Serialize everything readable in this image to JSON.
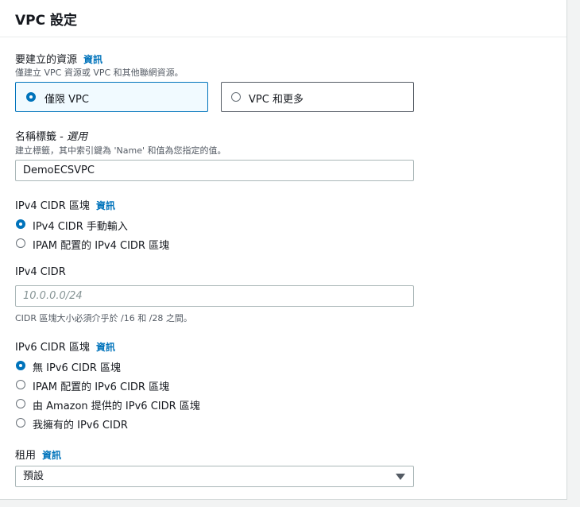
{
  "panel": {
    "title": "VPC 設定"
  },
  "resources": {
    "label": "要建立的資源",
    "info": "資訊",
    "description": "僅建立 VPC 資源或 VPC 和其他聯網資源。",
    "options": [
      {
        "label": "僅限 VPC",
        "selected": true
      },
      {
        "label": "VPC 和更多",
        "selected": false
      }
    ]
  },
  "name_tag": {
    "label": "名稱標籤 - ",
    "optional": "選用",
    "description": "建立標籤，其中索引鍵為 'Name' 和值為您指定的值。",
    "value": "DemoECSVPC"
  },
  "ipv4_block": {
    "label": "IPv4 CIDR 區塊",
    "info": "資訊",
    "options": [
      {
        "label": "IPv4 CIDR 手動輸入",
        "selected": true
      },
      {
        "label": "IPAM 配置的 IPv4 CIDR 區塊",
        "selected": false
      }
    ]
  },
  "ipv4_cidr": {
    "label": "IPv4 CIDR",
    "placeholder": "10.0.0.0/24",
    "hint": "CIDR 區塊大小必須介乎於 /16 和 /28 之間。"
  },
  "ipv6_block": {
    "label": "IPv6 CIDR 區塊",
    "info": "資訊",
    "options": [
      {
        "label": "無 IPv6 CIDR 區塊",
        "selected": true
      },
      {
        "label": "IPAM 配置的 IPv6 CIDR 區塊",
        "selected": false
      },
      {
        "label": "由 Amazon 提供的 IPv6 CIDR 區塊",
        "selected": false
      },
      {
        "label": "我擁有的 IPv6 CIDR",
        "selected": false
      }
    ]
  },
  "tenancy": {
    "label": "租用",
    "info": "資訊",
    "value": "預設"
  },
  "colors": {
    "accent": "#0073bb",
    "border": "#aab7b8",
    "text": "#16191f",
    "muted": "#545b64"
  }
}
